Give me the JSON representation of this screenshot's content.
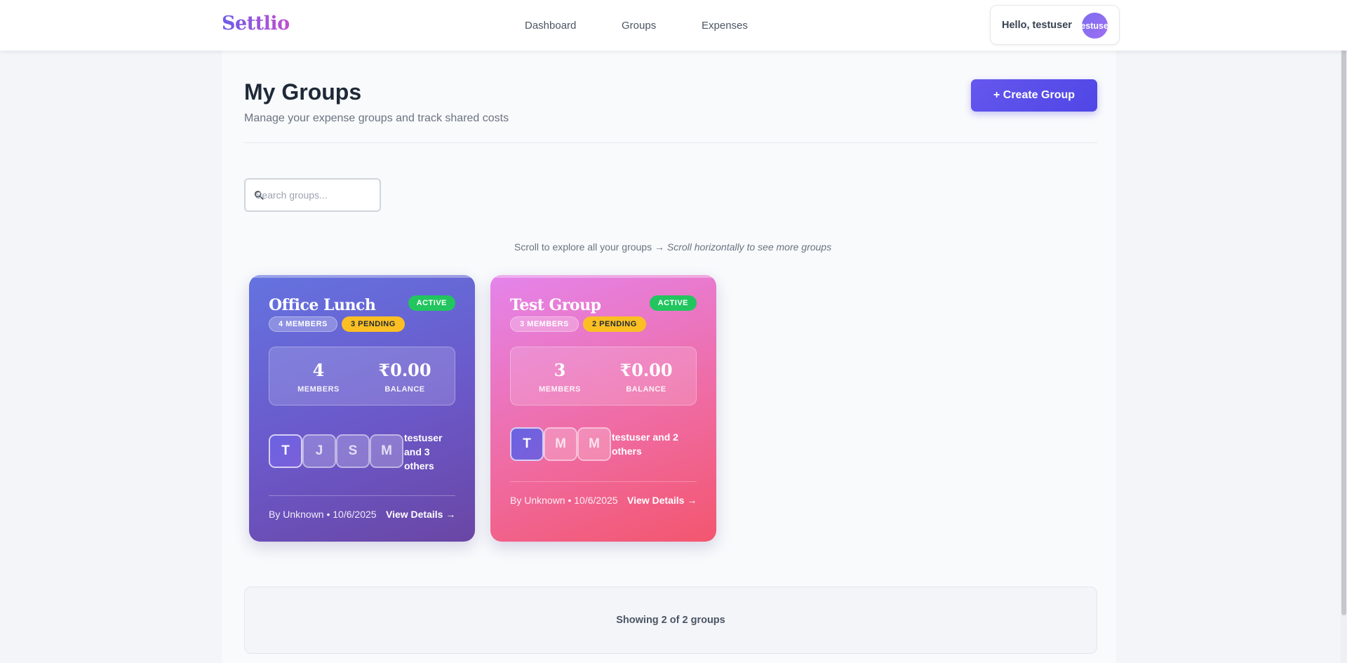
{
  "brand": {
    "logo": "Settlio"
  },
  "nav": {
    "items": [
      "Dashboard",
      "Groups",
      "Expenses"
    ]
  },
  "user": {
    "greeting": "Hello, testuser",
    "avatar_text": "testuser"
  },
  "page": {
    "title": "My Groups",
    "subtitle": "Manage your expense groups and track shared costs",
    "create_button": "+ Create Group"
  },
  "search": {
    "placeholder": "Search groups...",
    "icon": "search-icon"
  },
  "scroll_hint": {
    "text": "Scroll to explore all your groups → ",
    "emphasis": "Scroll horizontally to see more groups"
  },
  "groups": [
    {
      "name": "Office Lunch",
      "status": "ACTIVE",
      "members_pill": "4 MEMBERS",
      "pending_pill": "3 PENDING",
      "members_count": "4",
      "members_label": "MEMBERS",
      "balance": "₹0.00",
      "balance_label": "BALANCE",
      "avatars": [
        "T",
        "J",
        "S",
        "M"
      ],
      "members_text": "testuser and 3 others",
      "meta": "By Unknown • 10/6/2025",
      "view_link": "View Details →",
      "theme": "#6b58c9"
    },
    {
      "name": "Test Group",
      "status": "ACTIVE",
      "members_pill": "3 MEMBERS",
      "pending_pill": "2 PENDING",
      "members_count": "3",
      "members_label": "MEMBERS",
      "balance": "₹0.00",
      "balance_label": "BALANCE",
      "avatars": [
        "T",
        "M",
        "M"
      ],
      "members_text": "testuser and 2 others",
      "meta": "By Unknown • 10/6/2025",
      "view_link": "View Details →",
      "theme": "#ef6ca5"
    }
  ],
  "footer": {
    "showing": "Showing 2 of 2 groups"
  },
  "colors": {
    "accent": "#4f46e5",
    "active": "#22c55e",
    "pending": "#fbbf24"
  }
}
